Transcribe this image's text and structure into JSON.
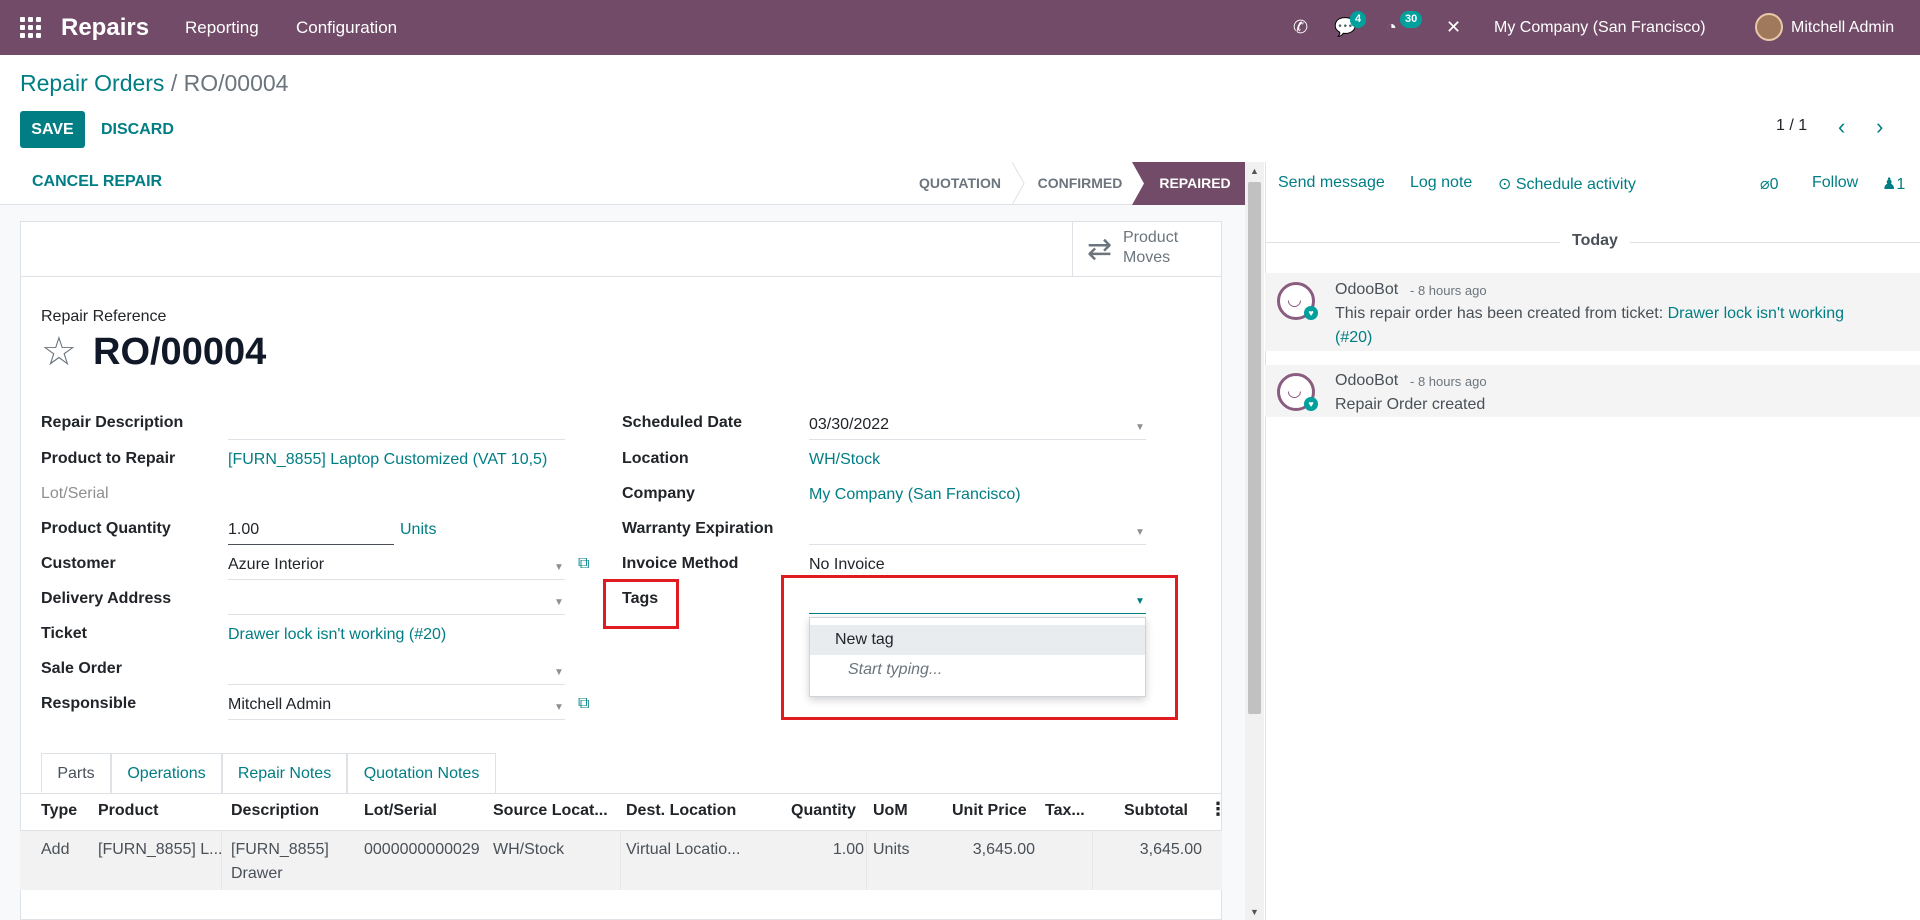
{
  "navbar": {
    "app_name": "Repairs",
    "menu": [
      "Reporting",
      "Configuration"
    ],
    "messages_count": "4",
    "activities_count": "30",
    "company": "My Company (San Francisco)",
    "user": "Mitchell Admin",
    "icons": [
      "apps-icon",
      "phone-icon",
      "messages-icon",
      "activities-icon",
      "debug-tools-icon"
    ]
  },
  "breadcrumb": {
    "parent": "Repair Orders",
    "separator": "/",
    "current": "RO/00004"
  },
  "buttons": {
    "save": "SAVE",
    "discard": "DISCARD",
    "cancel_repair": "CANCEL REPAIR"
  },
  "pager": {
    "value": "1 / 1"
  },
  "statusbar": {
    "stages": [
      "QUOTATION",
      "CONFIRMED",
      "REPAIRED"
    ],
    "active": "REPAIRED"
  },
  "smart_button": {
    "line1": "Product",
    "line2": "Moves",
    "icon": "exchange-arrows-icon"
  },
  "form": {
    "title_label": "Repair Reference",
    "title": "RO/00004",
    "left": {
      "repair_description": {
        "label": "Repair Description",
        "value": ""
      },
      "product_to_repair": {
        "label": "Product to Repair",
        "value": "[FURN_8855] Laptop Customized (VAT 10,5)"
      },
      "lot_serial": {
        "label": "Lot/Serial",
        "value": ""
      },
      "product_quantity": {
        "label": "Product Quantity",
        "value": "1.00",
        "uom": "Units"
      },
      "customer": {
        "label": "Customer",
        "value": "Azure Interior"
      },
      "delivery_address": {
        "label": "Delivery Address",
        "value": ""
      },
      "ticket": {
        "label": "Ticket",
        "value": "Drawer lock isn't working (#20)"
      },
      "sale_order": {
        "label": "Sale Order",
        "value": ""
      },
      "responsible": {
        "label": "Responsible",
        "value": "Mitchell Admin"
      }
    },
    "right": {
      "scheduled_date": {
        "label": "Scheduled Date",
        "value": "03/30/2022"
      },
      "location": {
        "label": "Location",
        "value": "WH/Stock"
      },
      "company": {
        "label": "Company",
        "value": "My Company (San Francisco)"
      },
      "warranty_expiration": {
        "label": "Warranty Expiration",
        "value": ""
      },
      "invoice_method": {
        "label": "Invoice Method",
        "value": "No Invoice"
      },
      "tags": {
        "label": "Tags",
        "value": ""
      }
    },
    "tags_dropdown": {
      "new_tag": "New tag",
      "hint": "Start typing..."
    }
  },
  "tabs": [
    "Parts",
    "Operations",
    "Repair Notes",
    "Quotation Notes"
  ],
  "active_tab": "Parts",
  "table": {
    "headers": [
      "Type",
      "Product",
      "Description",
      "Lot/Serial",
      "Source Locat...",
      "Dest. Location",
      "Quantity",
      "UoM",
      "Unit Price",
      "Tax...",
      "Subtotal"
    ],
    "rows": [
      {
        "type": "Add",
        "product": "[FURN_8855] L...",
        "description_1": "[FURN_8855]",
        "description_2": "Drawer",
        "lot": "0000000000029",
        "source": "WH/Stock",
        "dest": "Virtual Locatio...",
        "quantity": "1.00",
        "uom": "Units",
        "unit_price": "3,645.00",
        "taxes": "",
        "subtotal": "3,645.00"
      }
    ]
  },
  "chatter": {
    "send_message": "Send message",
    "log_note": "Log note",
    "schedule_activity": "Schedule activity",
    "attachments": "0",
    "follow": "Follow",
    "followers": "1",
    "date_separator": "Today",
    "messages": [
      {
        "author": "OdooBot",
        "date": "- 8 hours ago",
        "body_prefix": "This repair order has been created from ticket: ",
        "body_link": "Drawer lock isn't working",
        "body_link_2": "(#20)"
      },
      {
        "author": "OdooBot",
        "date": "- 8 hours ago",
        "body": "Repair Order created"
      }
    ]
  },
  "colors": {
    "brand": "#714B67",
    "accent": "#017e84",
    "badge": "#00A09D",
    "highlight": "#e11b22"
  }
}
